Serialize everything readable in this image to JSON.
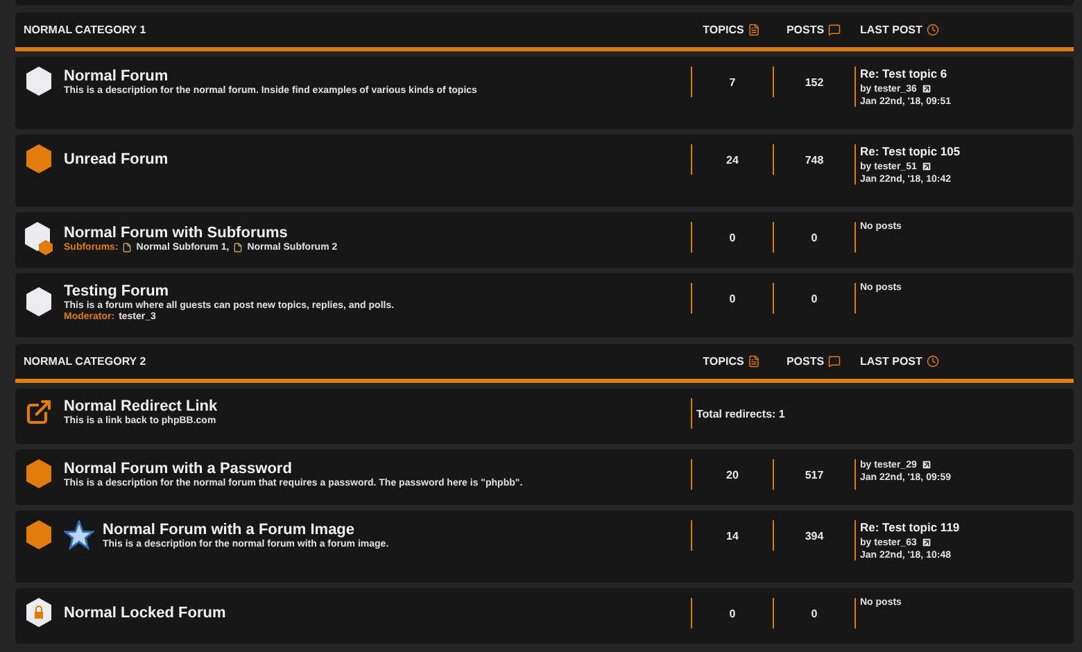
{
  "categories": [
    {
      "title": "NORMAL CATEGORY 1",
      "columns": [
        "TOPICS",
        "POSTS",
        "LAST POST"
      ],
      "forums": [
        {
          "kind": "read",
          "forum_image": false,
          "title": "Normal Forum",
          "description": "This is a description for the normal forum. Inside find examples of various kinds of topics",
          "topics": "7",
          "posts": "152",
          "last_post": {
            "title": "Re: Test topic 6",
            "by": "by tester_36",
            "date": "Jan 22nd, '18, 09:51"
          }
        },
        {
          "kind": "unread",
          "forum_image": false,
          "title": "Unread Forum",
          "topics": "24",
          "posts": "748",
          "last_post": {
            "title": "Re: Test topic 105",
            "by": "by tester_51",
            "date": "Jan 22nd, '18, 10:42"
          }
        },
        {
          "kind": "subforums",
          "forum_image": false,
          "title": "Normal Forum with Subforums",
          "subforums_label": "Subforums:",
          "subforums": [
            "Normal Subforum 1,",
            "Normal Subforum 2"
          ],
          "topics": "0",
          "posts": "0",
          "no_posts": "No posts"
        },
        {
          "kind": "read",
          "forum_image": false,
          "title": "Testing Forum",
          "description": "This is a forum where all guests can post new topics, replies, and polls.",
          "moderator_label": "Moderator:",
          "moderator": "tester_3",
          "topics": "0",
          "posts": "0",
          "no_posts": "No posts"
        }
      ]
    },
    {
      "title": "NORMAL CATEGORY 2",
      "columns": [
        "TOPICS",
        "POSTS",
        "LAST POST"
      ],
      "forums": [
        {
          "kind": "link",
          "forum_image": false,
          "title": "Normal Redirect Link",
          "description": "This is a link back to phpBB.com",
          "redirects": "Total redirects: 1"
        },
        {
          "kind": "unread",
          "forum_image": false,
          "title": "Normal Forum with a Password",
          "description": "This is a description for the normal forum that requires a password. The password here is \"phpbb\".",
          "topics": "20",
          "posts": "517",
          "last_post": {
            "by": "by tester_29",
            "date": "Jan 22nd, '18, 09:59"
          }
        },
        {
          "kind": "unread",
          "forum_image": true,
          "title": "Normal Forum with a Forum Image",
          "description": "This is a description for the normal forum with a forum image.",
          "topics": "14",
          "posts": "394",
          "last_post": {
            "title": "Re: Test topic 119",
            "by": "by tester_63",
            "date": "Jan 22nd, '18, 10:48"
          }
        },
        {
          "kind": "locked",
          "forum_image": false,
          "title": "Normal Locked Forum",
          "topics": "0",
          "posts": "0",
          "no_posts": "No posts"
        }
      ]
    }
  ]
}
